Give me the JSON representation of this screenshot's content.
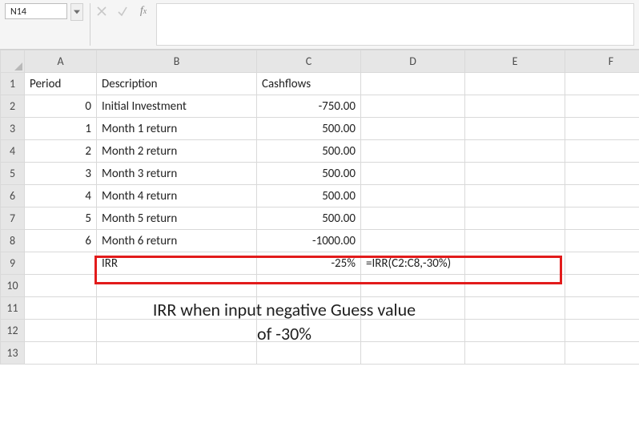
{
  "formula_bar": {
    "cell_reference": "N14",
    "formula_value": ""
  },
  "columns": [
    "A",
    "B",
    "C",
    "D",
    "E",
    "F"
  ],
  "row_numbers": [
    "1",
    "2",
    "3",
    "4",
    "5",
    "6",
    "7",
    "8",
    "9",
    "10",
    "11",
    "12",
    "13"
  ],
  "headers": {
    "A1": "Period",
    "B1": "Description",
    "C1": "Cashflows"
  },
  "rows": [
    {
      "period": "0",
      "desc": "Initial Investment",
      "cash": "-750.00"
    },
    {
      "period": "1",
      "desc": "Month 1 return",
      "cash": "500.00"
    },
    {
      "period": "2",
      "desc": "Month 2 return",
      "cash": "500.00"
    },
    {
      "period": "3",
      "desc": "Month 3 return",
      "cash": "500.00"
    },
    {
      "period": "4",
      "desc": "Month 4 return",
      "cash": "500.00"
    },
    {
      "period": "5",
      "desc": "Month 5 return",
      "cash": "500.00"
    },
    {
      "period": "6",
      "desc": "Month 6 return",
      "cash": "-1000.00"
    }
  ],
  "irr": {
    "label": "IRR",
    "value": "-25%",
    "formula": "=IRR(C2:C8,-30%)"
  },
  "caption": {
    "line1": "IRR when input negative Guess value",
    "line2": "of -30%"
  },
  "colors": {
    "highlight": "#e21b1b"
  },
  "chart_data": {
    "type": "table",
    "title": "IRR when input negative Guess value of -30%",
    "columns": [
      "Period",
      "Description",
      "Cashflows"
    ],
    "rows": [
      [
        "0",
        "Initial Investment",
        -750.0
      ],
      [
        "1",
        "Month 1 return",
        500.0
      ],
      [
        "2",
        "Month 2 return",
        500.0
      ],
      [
        "3",
        "Month 3 return",
        500.0
      ],
      [
        "4",
        "Month 4 return",
        500.0
      ],
      [
        "5",
        "Month 5 return",
        500.0
      ],
      [
        "6",
        "Month 6 return",
        -1000.0
      ]
    ],
    "result": {
      "label": "IRR",
      "value_percent": -25,
      "formula": "=IRR(C2:C8,-30%)"
    }
  }
}
